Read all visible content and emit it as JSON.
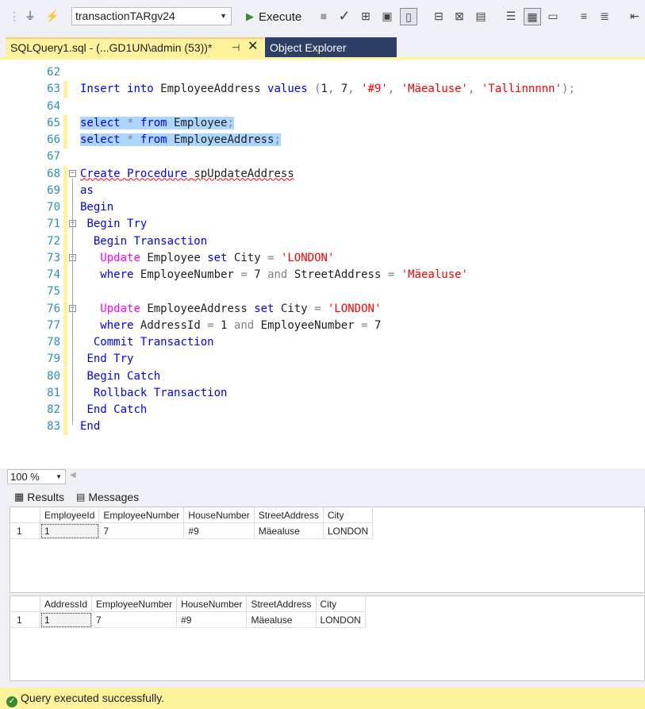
{
  "toolbar": {
    "database": "transactionTARgv24",
    "execute_label": "Execute"
  },
  "tabs": {
    "active": "SQLQuery1.sql - (...GD1UN\\admin (53))*",
    "inactive": "Object Explorer"
  },
  "editor": {
    "lines": [
      {
        "n": "62"
      },
      {
        "n": "63",
        "t": [
          "Insert into EmployeeAddress values (1, 7, '#9', 'Mäealuse', 'Tallinnnnn');"
        ]
      },
      {
        "n": "64"
      },
      {
        "n": "65",
        "t": [
          "select * from Employee;"
        ]
      },
      {
        "n": "66",
        "t": [
          "select * from EmployeeAddress;"
        ]
      },
      {
        "n": "67"
      },
      {
        "n": "68",
        "t": [
          "Create Procedure spUpdateAddress"
        ]
      },
      {
        "n": "69",
        "t": [
          "as"
        ]
      },
      {
        "n": "70",
        "t": [
          "Begin"
        ]
      },
      {
        "n": "71",
        "t": [
          " Begin Try"
        ]
      },
      {
        "n": "72",
        "t": [
          "  Begin Transaction"
        ]
      },
      {
        "n": "73",
        "t": [
          "   Update Employee set City = 'LONDON'"
        ]
      },
      {
        "n": "74",
        "t": [
          "   where EmployeeNumber = 7 and StreetAddress = 'Mäealuse'"
        ]
      },
      {
        "n": "75"
      },
      {
        "n": "76",
        "t": [
          "   Update EmployeeAddress set City = 'LONDON'"
        ]
      },
      {
        "n": "77",
        "t": [
          "   where AddressId = 1 and EmployeeNumber = 7"
        ]
      },
      {
        "n": "78",
        "t": [
          "  Commit Transaction"
        ]
      },
      {
        "n": "79",
        "t": [
          " End Try"
        ]
      },
      {
        "n": "80",
        "t": [
          " Begin Catch"
        ]
      },
      {
        "n": "81",
        "t": [
          "  Rollback Transaction"
        ]
      },
      {
        "n": "82",
        "t": [
          " End Catch"
        ]
      },
      {
        "n": "83",
        "t": [
          "End"
        ]
      }
    ]
  },
  "zoom": "100 %",
  "result_tabs": {
    "results": "Results",
    "messages": "Messages"
  },
  "grid1": {
    "columns": [
      "EmployeeId",
      "EmployeeNumber",
      "HouseNumber",
      "StreetAddress",
      "City"
    ],
    "rows": [
      [
        "1",
        "1",
        "7",
        "#9",
        "Mäealuse",
        "LONDON"
      ]
    ]
  },
  "grid2": {
    "columns": [
      "AddressId",
      "EmployeeNumber",
      "HouseNumber",
      "StreetAddress",
      "City"
    ],
    "rows": [
      [
        "1",
        "1",
        "7",
        "#9",
        "Mäealuse",
        "LONDON"
      ]
    ]
  },
  "status": "Query executed successfully."
}
